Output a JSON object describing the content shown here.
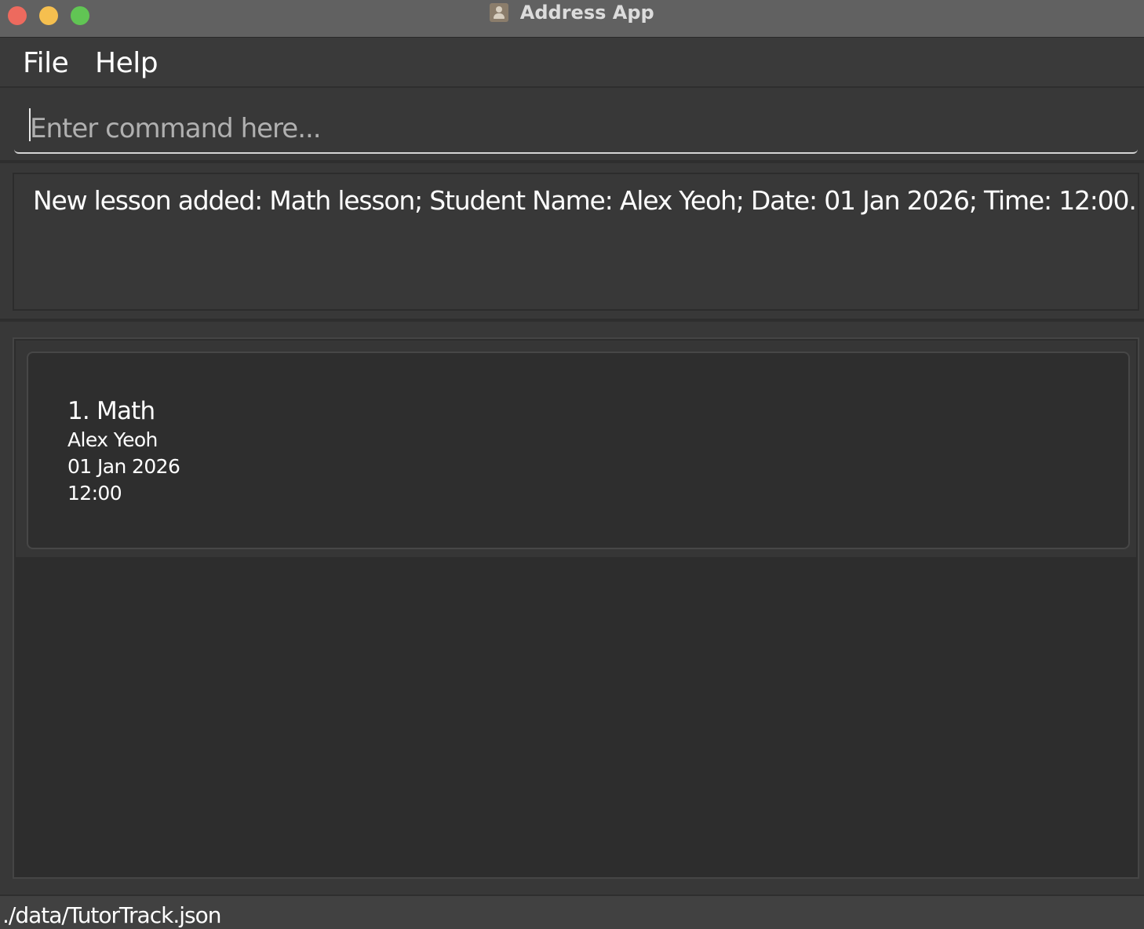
{
  "window": {
    "title": "Address App"
  },
  "menu": {
    "file_label": "File",
    "help_label": "Help"
  },
  "command": {
    "placeholder": "Enter command here...",
    "value": ""
  },
  "result": {
    "message": "New lesson added: Math lesson; Student Name: Alex Yeoh; Date: 01 Jan 2026; Time: 12:00."
  },
  "lessons": [
    {
      "title": "1. Math",
      "student": "Alex Yeoh",
      "date": "01 Jan 2026",
      "time": "12:00"
    }
  ],
  "status": {
    "file_path": "./data/TutorTrack.json"
  },
  "colors": {
    "close": "#ed6a5e",
    "minimize": "#f5bf4f",
    "maximize": "#61c554",
    "background": "#383838",
    "list_background": "#2d2d2d"
  },
  "icons": {
    "app": "address-book-icon"
  }
}
